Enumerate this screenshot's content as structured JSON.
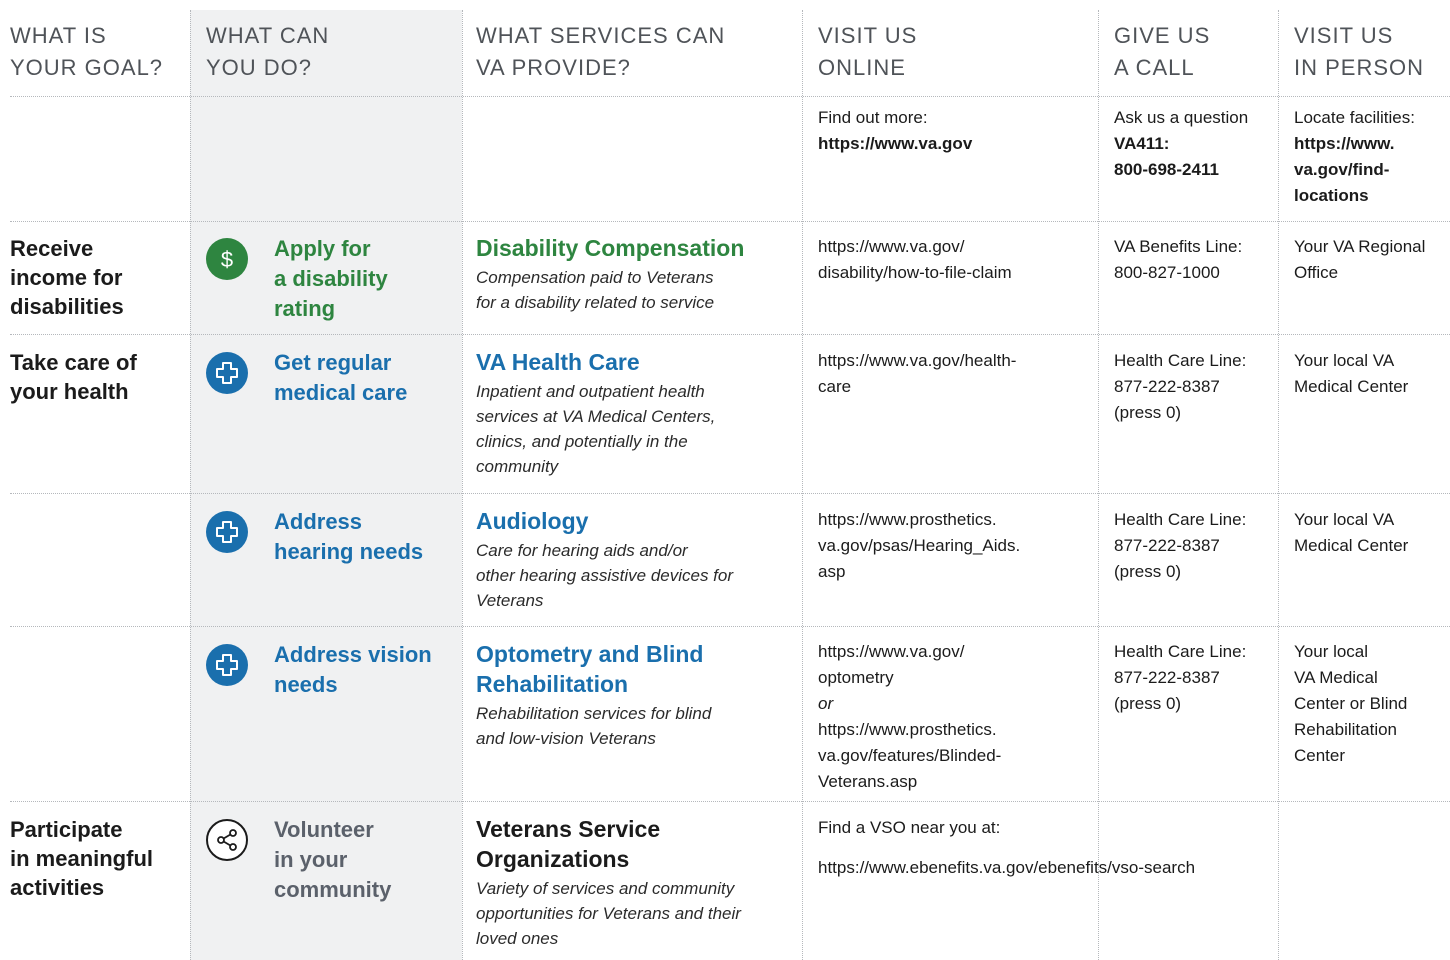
{
  "colors": {
    "green": "#2e8540",
    "blue": "#1a6fad",
    "gray": "#5b616b",
    "shade": "#f0f1f2"
  },
  "headers": [
    [
      "WHAT IS",
      "YOUR GOAL?"
    ],
    [
      "WHAT CAN",
      "YOU DO?"
    ],
    [
      "WHAT SERVICES CAN",
      "VA PROVIDE?"
    ],
    [
      "VISIT US",
      "ONLINE"
    ],
    [
      "GIVE US",
      "A CALL"
    ],
    [
      "VISIT US",
      "IN PERSON"
    ]
  ],
  "intro": {
    "online": {
      "label": "Find out more:",
      "value": "https://www.va.gov"
    },
    "call": {
      "label": "Ask us a question",
      "value_lines": [
        "VA411:",
        "800-698-2411"
      ]
    },
    "person": {
      "label": "Locate facilities:",
      "value_lines": [
        "https://www.",
        "va.gov/find-",
        "locations"
      ]
    }
  },
  "rows": [
    {
      "goal": [
        "Receive",
        "income for",
        "disabilities"
      ],
      "icon": "dollar-icon",
      "action": [
        "Apply for",
        "a disability",
        "rating"
      ],
      "service_title": [
        "Disability Compensation"
      ],
      "service_desc": [
        "Compensation paid to Veterans",
        "for a disability related to service"
      ],
      "online": [
        "https://www.va.gov/",
        "disability/how-to-file-claim"
      ],
      "call": [
        "VA Benefits Line:",
        "800-827-1000"
      ],
      "person": [
        "Your VA Regional",
        "Office"
      ]
    },
    {
      "goal": [
        "Take care of",
        "your health"
      ],
      "icon": "medical-cross-icon",
      "action": [
        "Get regular",
        "medical care"
      ],
      "service_title": [
        "VA Health Care"
      ],
      "service_desc": [
        "Inpatient and outpatient health",
        "services at VA Medical Centers,",
        "clinics, and potentially in the",
        "community"
      ],
      "online": [
        "https://www.va.gov/health-",
        "care"
      ],
      "call": [
        "Health Care Line:",
        "877-222-8387",
        "(press 0)"
      ],
      "person": [
        "Your local VA",
        "Medical Center"
      ]
    },
    {
      "goal": [],
      "icon": "medical-cross-icon",
      "action": [
        "Address",
        "hearing needs"
      ],
      "service_title": [
        "Audiology"
      ],
      "service_desc": [
        "Care for hearing aids and/or",
        "other hearing assistive devices for",
        "Veterans"
      ],
      "online": [
        "https://www.prosthetics.",
        "va.gov/psas/Hearing_Aids.",
        "asp"
      ],
      "call": [
        "Health Care Line:",
        "877-222-8387",
        "(press 0)"
      ],
      "person": [
        "Your local VA",
        "Medical Center"
      ]
    },
    {
      "goal": [],
      "icon": "medical-cross-icon",
      "action": [
        "Address vision",
        "needs"
      ],
      "service_title": [
        "Optometry and Blind",
        "Rehabilitation"
      ],
      "service_desc": [
        "Rehabilitation services for blind",
        "and low-vision Veterans"
      ],
      "online": [
        "https://www.va.gov/",
        "optometry",
        "or",
        "https://www.prosthetics.",
        "va.gov/features/Blinded-",
        "Veterans.asp"
      ],
      "call": [
        "Health Care Line:",
        "877-222-8387",
        "(press 0)"
      ],
      "person": [
        "Your local",
        "VA Medical",
        "Center or Blind",
        "Rehabilitation",
        "Center"
      ]
    },
    {
      "goal": [
        "Participate",
        "in meaningful",
        "activities"
      ],
      "icon": "share-icon",
      "action": [
        "Volunteer",
        "in your",
        "community"
      ],
      "service_title": [
        "Veterans Service",
        "Organizations"
      ],
      "service_desc": [
        "Variety of services and community",
        "opportunities for Veterans and their",
        "loved ones"
      ],
      "online_label": "Find a VSO near you at:",
      "online_url": "https://www.ebenefits.va.gov/ebenefits/vso-search"
    }
  ]
}
